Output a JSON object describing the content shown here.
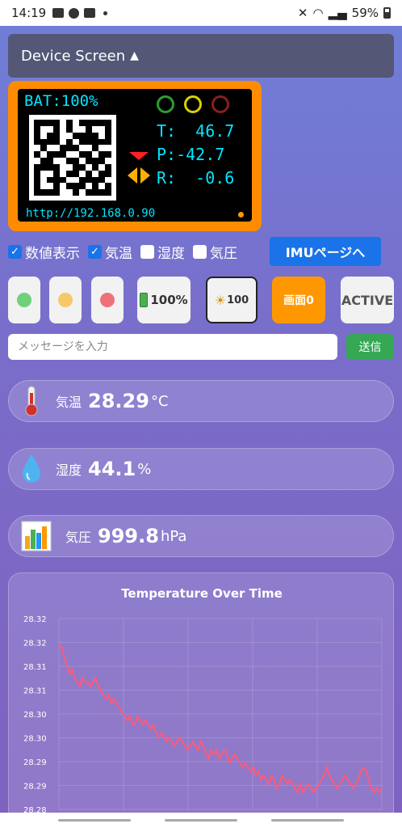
{
  "status": {
    "time": "14:19",
    "battery": "59%"
  },
  "device": {
    "header_label": "Device Screen",
    "header_arrow": "▲",
    "lcd": {
      "bat": "BAT:100%",
      "t_line": "T:  46.7",
      "p_line": "P:-42.7",
      "r_line": "R:  -0.6",
      "url": "http://192.168.0.90"
    }
  },
  "checks": [
    {
      "label": "数値表示",
      "checked": true
    },
    {
      "label": "気温",
      "checked": true
    },
    {
      "label": "湿度",
      "checked": false
    },
    {
      "label": "気圧",
      "checked": false
    }
  ],
  "imu_button": "IMUページへ",
  "buttons": {
    "battery": "100%",
    "brightness": "100",
    "screen": "画面0",
    "active": "ACTIVE"
  },
  "message": {
    "placeholder": "メッセージを入力",
    "send": "送信"
  },
  "sensors": {
    "temperature": {
      "label": "気温",
      "value": "28.29",
      "unit": "°C"
    },
    "humidity": {
      "label": "湿度",
      "value": "44.1",
      "unit": "%"
    },
    "pressure": {
      "label": "気圧",
      "value": "999.8",
      "unit": "hPa"
    }
  },
  "colors": {
    "line": "#ff5a7a",
    "lcd_frame": "#ff8c00",
    "primary": "#1a73e8",
    "send": "#34a853"
  },
  "chart_data": {
    "type": "line",
    "title": "Temperature Over Time",
    "ytick_labels": [
      "28.32",
      "28.32",
      "28.31",
      "28.31",
      "28.30",
      "28.30",
      "28.29",
      "28.29",
      "28.28"
    ],
    "ylim": [
      28.28,
      28.325
    ],
    "grid": true,
    "series": [
      {
        "values": [
          28.319,
          28.318,
          28.316,
          28.314,
          28.312,
          28.313,
          28.311,
          28.31,
          28.309,
          28.311,
          28.31,
          28.31,
          28.309,
          28.31,
          28.311,
          28.309,
          28.308,
          28.307,
          28.306,
          28.307,
          28.305,
          28.306,
          28.305,
          28.304,
          28.303,
          28.302,
          28.301,
          28.302,
          28.3,
          28.3,
          28.302,
          28.301,
          28.3,
          28.301,
          28.3,
          28.299,
          28.3,
          28.298,
          28.297,
          28.298,
          28.297,
          28.296,
          28.297,
          28.296,
          28.295,
          28.296,
          28.297,
          28.296,
          28.295,
          28.294,
          28.295,
          28.296,
          28.295,
          28.294,
          28.296,
          28.295,
          28.293,
          28.292,
          28.294,
          28.293,
          28.294,
          28.292,
          28.293,
          28.294,
          28.293,
          28.291,
          28.292,
          28.293,
          28.292,
          28.291,
          28.29,
          28.291,
          28.29,
          28.289,
          28.29,
          28.288,
          28.289,
          28.287,
          28.288,
          28.287,
          28.286,
          28.288,
          28.287,
          28.285,
          28.286,
          28.288,
          28.287,
          28.286,
          28.287,
          28.286,
          28.285,
          28.284,
          28.286,
          28.284,
          28.285,
          28.286,
          28.285,
          28.284,
          28.285,
          28.286,
          28.287,
          28.288,
          28.29,
          28.288,
          28.287,
          28.286,
          28.285,
          28.286,
          28.287,
          28.288,
          28.287,
          28.286,
          28.285,
          28.286,
          28.287,
          28.289,
          28.29,
          28.289,
          28.287,
          28.285,
          28.284,
          28.285,
          28.284,
          28.285
        ]
      }
    ]
  }
}
